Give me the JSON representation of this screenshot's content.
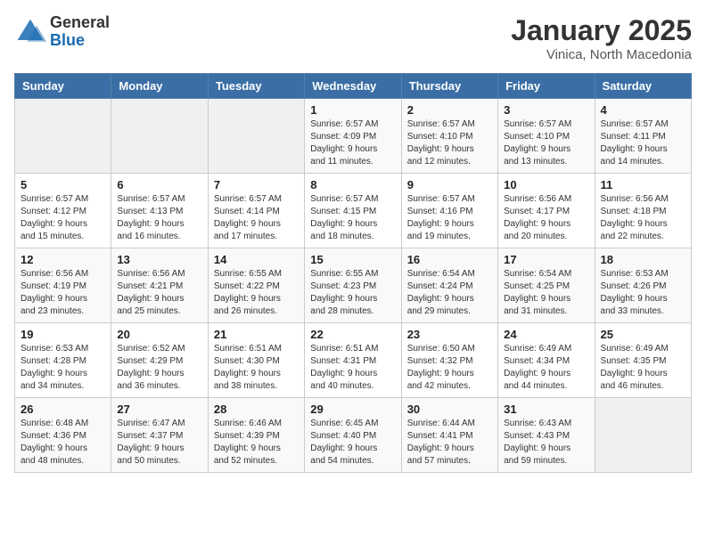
{
  "header": {
    "logo_general": "General",
    "logo_blue": "Blue",
    "title": "January 2025",
    "subtitle": "Vinica, North Macedonia"
  },
  "weekdays": [
    "Sunday",
    "Monday",
    "Tuesday",
    "Wednesday",
    "Thursday",
    "Friday",
    "Saturday"
  ],
  "weeks": [
    [
      {
        "day": "",
        "info": ""
      },
      {
        "day": "",
        "info": ""
      },
      {
        "day": "",
        "info": ""
      },
      {
        "day": "1",
        "info": "Sunrise: 6:57 AM\nSunset: 4:09 PM\nDaylight: 9 hours\nand 11 minutes."
      },
      {
        "day": "2",
        "info": "Sunrise: 6:57 AM\nSunset: 4:10 PM\nDaylight: 9 hours\nand 12 minutes."
      },
      {
        "day": "3",
        "info": "Sunrise: 6:57 AM\nSunset: 4:10 PM\nDaylight: 9 hours\nand 13 minutes."
      },
      {
        "day": "4",
        "info": "Sunrise: 6:57 AM\nSunset: 4:11 PM\nDaylight: 9 hours\nand 14 minutes."
      }
    ],
    [
      {
        "day": "5",
        "info": "Sunrise: 6:57 AM\nSunset: 4:12 PM\nDaylight: 9 hours\nand 15 minutes."
      },
      {
        "day": "6",
        "info": "Sunrise: 6:57 AM\nSunset: 4:13 PM\nDaylight: 9 hours\nand 16 minutes."
      },
      {
        "day": "7",
        "info": "Sunrise: 6:57 AM\nSunset: 4:14 PM\nDaylight: 9 hours\nand 17 minutes."
      },
      {
        "day": "8",
        "info": "Sunrise: 6:57 AM\nSunset: 4:15 PM\nDaylight: 9 hours\nand 18 minutes."
      },
      {
        "day": "9",
        "info": "Sunrise: 6:57 AM\nSunset: 4:16 PM\nDaylight: 9 hours\nand 19 minutes."
      },
      {
        "day": "10",
        "info": "Sunrise: 6:56 AM\nSunset: 4:17 PM\nDaylight: 9 hours\nand 20 minutes."
      },
      {
        "day": "11",
        "info": "Sunrise: 6:56 AM\nSunset: 4:18 PM\nDaylight: 9 hours\nand 22 minutes."
      }
    ],
    [
      {
        "day": "12",
        "info": "Sunrise: 6:56 AM\nSunset: 4:19 PM\nDaylight: 9 hours\nand 23 minutes."
      },
      {
        "day": "13",
        "info": "Sunrise: 6:56 AM\nSunset: 4:21 PM\nDaylight: 9 hours\nand 25 minutes."
      },
      {
        "day": "14",
        "info": "Sunrise: 6:55 AM\nSunset: 4:22 PM\nDaylight: 9 hours\nand 26 minutes."
      },
      {
        "day": "15",
        "info": "Sunrise: 6:55 AM\nSunset: 4:23 PM\nDaylight: 9 hours\nand 28 minutes."
      },
      {
        "day": "16",
        "info": "Sunrise: 6:54 AM\nSunset: 4:24 PM\nDaylight: 9 hours\nand 29 minutes."
      },
      {
        "day": "17",
        "info": "Sunrise: 6:54 AM\nSunset: 4:25 PM\nDaylight: 9 hours\nand 31 minutes."
      },
      {
        "day": "18",
        "info": "Sunrise: 6:53 AM\nSunset: 4:26 PM\nDaylight: 9 hours\nand 33 minutes."
      }
    ],
    [
      {
        "day": "19",
        "info": "Sunrise: 6:53 AM\nSunset: 4:28 PM\nDaylight: 9 hours\nand 34 minutes."
      },
      {
        "day": "20",
        "info": "Sunrise: 6:52 AM\nSunset: 4:29 PM\nDaylight: 9 hours\nand 36 minutes."
      },
      {
        "day": "21",
        "info": "Sunrise: 6:51 AM\nSunset: 4:30 PM\nDaylight: 9 hours\nand 38 minutes."
      },
      {
        "day": "22",
        "info": "Sunrise: 6:51 AM\nSunset: 4:31 PM\nDaylight: 9 hours\nand 40 minutes."
      },
      {
        "day": "23",
        "info": "Sunrise: 6:50 AM\nSunset: 4:32 PM\nDaylight: 9 hours\nand 42 minutes."
      },
      {
        "day": "24",
        "info": "Sunrise: 6:49 AM\nSunset: 4:34 PM\nDaylight: 9 hours\nand 44 minutes."
      },
      {
        "day": "25",
        "info": "Sunrise: 6:49 AM\nSunset: 4:35 PM\nDaylight: 9 hours\nand 46 minutes."
      }
    ],
    [
      {
        "day": "26",
        "info": "Sunrise: 6:48 AM\nSunset: 4:36 PM\nDaylight: 9 hours\nand 48 minutes."
      },
      {
        "day": "27",
        "info": "Sunrise: 6:47 AM\nSunset: 4:37 PM\nDaylight: 9 hours\nand 50 minutes."
      },
      {
        "day": "28",
        "info": "Sunrise: 6:46 AM\nSunset: 4:39 PM\nDaylight: 9 hours\nand 52 minutes."
      },
      {
        "day": "29",
        "info": "Sunrise: 6:45 AM\nSunset: 4:40 PM\nDaylight: 9 hours\nand 54 minutes."
      },
      {
        "day": "30",
        "info": "Sunrise: 6:44 AM\nSunset: 4:41 PM\nDaylight: 9 hours\nand 57 minutes."
      },
      {
        "day": "31",
        "info": "Sunrise: 6:43 AM\nSunset: 4:43 PM\nDaylight: 9 hours\nand 59 minutes."
      },
      {
        "day": "",
        "info": ""
      }
    ]
  ]
}
